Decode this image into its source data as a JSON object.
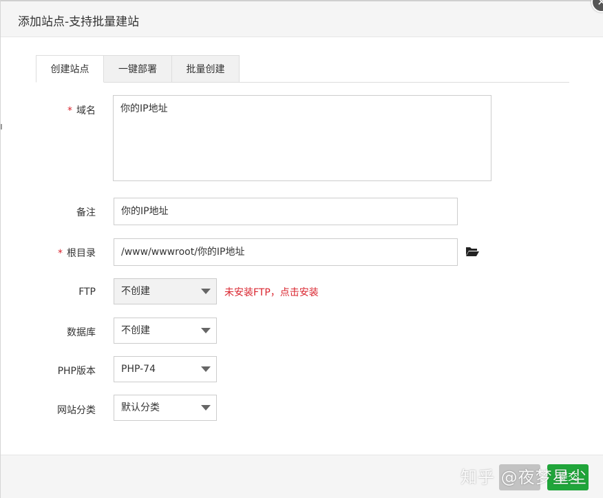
{
  "dialog": {
    "title": "添加站点-支持批量建站"
  },
  "tabs": [
    {
      "label": "创建站点",
      "active": true
    },
    {
      "label": "一键部署",
      "active": false
    },
    {
      "label": "批量创建",
      "active": false
    }
  ],
  "form": {
    "domain": {
      "required_mark": "*",
      "label": "域名",
      "value": "你的IP地址"
    },
    "remark": {
      "label": "备注",
      "value": "你的IP地址"
    },
    "root_dir": {
      "required_mark": "*",
      "label": "根目录",
      "value": "/www/wwwroot/你的IP地址",
      "icon": "folder-open-icon"
    },
    "ftp": {
      "label": "FTP",
      "selected": "不创建",
      "warning": "未安装FTP，点击安装"
    },
    "database": {
      "label": "数据库",
      "selected": "不创建"
    },
    "php_version": {
      "label": "PHP版本",
      "selected": "PHP-74"
    },
    "site_category": {
      "label": "网站分类",
      "selected": "默认分类"
    }
  },
  "footer": {
    "submit_label": "提交"
  },
  "watermark": {
    "text": "知乎 @夜梦星尘"
  },
  "colors": {
    "accent_green": "#20a53a",
    "warning_red": "#d9232d"
  }
}
